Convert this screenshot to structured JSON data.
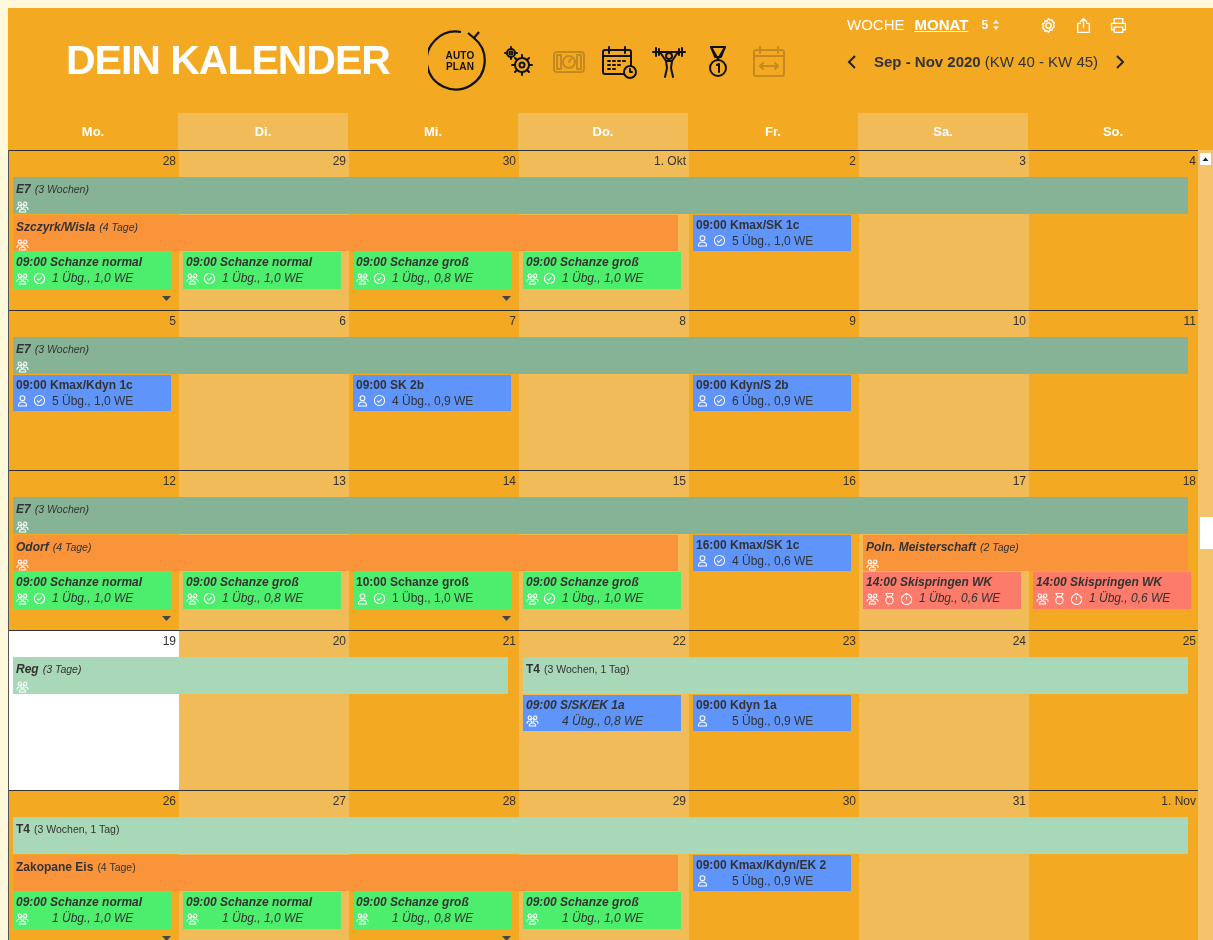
{
  "header": {
    "title": "DEIN KALENDER"
  },
  "toolbar": {
    "autoplan": {
      "line1": "AUTO",
      "line2": "PLAN"
    },
    "tools": [
      {
        "kind": "gears",
        "disabled": false
      },
      {
        "kind": "scale",
        "disabled": true
      },
      {
        "kind": "calendar-clock",
        "disabled": false
      },
      {
        "kind": "athlete",
        "disabled": false
      },
      {
        "kind": "medal",
        "disabled": false
      },
      {
        "kind": "calendar-arrows",
        "disabled": true
      }
    ]
  },
  "view_modes": [
    {
      "label": "WOCHE",
      "selected": false
    },
    {
      "label": "MONAT",
      "selected": true
    }
  ],
  "weeks_shown": "5",
  "actions": [
    {
      "kind": "settings"
    },
    {
      "kind": "share"
    },
    {
      "kind": "print"
    }
  ],
  "range": {
    "label": "Sep - Nov 2020",
    "weeks": "(KW 40 - KW 45)"
  },
  "weekdays": [
    "Mo.",
    "Di.",
    "Mi.",
    "Do.",
    "Fr.",
    "Sa.",
    "So."
  ],
  "weeks": [
    {
      "days": [
        {
          "date": "28",
          "today": false,
          "more": true
        },
        {
          "date": "29",
          "today": false,
          "more": false
        },
        {
          "date": "30",
          "today": false,
          "more": true
        },
        {
          "date": "1. Okt",
          "today": false,
          "more": false
        },
        {
          "date": "2",
          "today": false,
          "more": false
        },
        {
          "date": "3",
          "today": false,
          "more": false
        },
        {
          "date": "4",
          "today": false,
          "more": false
        }
      ],
      "lanes": [
        [
          {
            "kind": "band",
            "title": "E7",
            "note": "(3 Wochen)",
            "color": "#86b396",
            "planned": true,
            "team": true
          },
          {
            "kind": "continued"
          },
          {
            "kind": "continued"
          },
          {
            "kind": "continued"
          },
          {
            "kind": "continued"
          },
          {
            "kind": "continued"
          },
          {
            "kind": "continued"
          }
        ],
        [
          {
            "kind": "band",
            "title": "Szczyrk/Wisla",
            "note": "(4 Tage)",
            "color": "#f9943a",
            "planned": true,
            "team": true
          },
          {
            "kind": "continued"
          },
          {
            "kind": "continued"
          },
          {
            "kind": "continued"
          },
          {
            "kind": "session",
            "title": "09:00 Kmax/SK 1c",
            "info": "5 Übg., 1,0 WE",
            "color": "#5f94fb",
            "planned": false,
            "team": false,
            "checked": true,
            "competition": false
          }
        ],
        [
          {
            "kind": "session",
            "title": "09:00 Schanze normal",
            "info": "1 Übg., 1,0 WE",
            "color": "#4ded6d",
            "planned": true,
            "team": true,
            "checked": true,
            "competition": false
          },
          {
            "kind": "session",
            "title": "09:00 Schanze normal",
            "info": "1 Übg., 1,0 WE",
            "color": "#4ded6d",
            "planned": true,
            "team": true,
            "checked": true,
            "competition": false
          },
          {
            "kind": "session",
            "title": "09:00 Schanze groß",
            "info": "1 Übg., 0,8 WE",
            "color": "#4ded6d",
            "planned": true,
            "team": true,
            "checked": true,
            "competition": false
          },
          {
            "kind": "session",
            "title": "09:00 Schanze groß",
            "info": "1 Übg., 1,0 WE",
            "color": "#4ded6d",
            "planned": true,
            "team": true,
            "checked": true,
            "competition": false
          }
        ]
      ]
    },
    {
      "days": [
        {
          "date": "5",
          "today": false,
          "more": false
        },
        {
          "date": "6",
          "today": false,
          "more": false
        },
        {
          "date": "7",
          "today": false,
          "more": false
        },
        {
          "date": "8",
          "today": false,
          "more": false
        },
        {
          "date": "9",
          "today": false,
          "more": false
        },
        {
          "date": "10",
          "today": false,
          "more": false
        },
        {
          "date": "11",
          "today": false,
          "more": false
        }
      ],
      "lanes": [
        [
          {
            "kind": "band",
            "title": "E7",
            "note": "(3 Wochen)",
            "color": "#86b396",
            "planned": true,
            "team": true
          },
          {
            "kind": "continued"
          },
          {
            "kind": "continued"
          },
          {
            "kind": "continued"
          },
          {
            "kind": "continued"
          },
          {
            "kind": "continued"
          },
          {
            "kind": "continued"
          }
        ],
        [
          {
            "kind": "session",
            "title": "09:00 Kmax/Kdyn 1c",
            "info": "5 Übg., 1,0 WE",
            "color": "#5f94fb",
            "planned": false,
            "team": false,
            "checked": true,
            "competition": false
          },
          {
            "kind": "empty"
          },
          {
            "kind": "session",
            "title": "09:00 SK 2b",
            "info": "4 Übg., 0,9 WE",
            "color": "#5f94fb",
            "planned": false,
            "team": false,
            "checked": true,
            "competition": false
          },
          {
            "kind": "empty"
          },
          {
            "kind": "session",
            "title": "09:00 Kdyn/S 2b",
            "info": "6 Übg., 0,9 WE",
            "color": "#5f94fb",
            "planned": false,
            "team": false,
            "checked": true,
            "competition": false
          }
        ]
      ]
    },
    {
      "days": [
        {
          "date": "12",
          "today": false,
          "more": true
        },
        {
          "date": "13",
          "today": false,
          "more": false
        },
        {
          "date": "14",
          "today": false,
          "more": true
        },
        {
          "date": "15",
          "today": false,
          "more": false
        },
        {
          "date": "16",
          "today": false,
          "more": false
        },
        {
          "date": "17",
          "today": false,
          "more": false
        },
        {
          "date": "18",
          "today": false,
          "more": false
        }
      ],
      "lanes": [
        [
          {
            "kind": "band",
            "title": "E7",
            "note": "(3 Wochen)",
            "color": "#86b396",
            "planned": true,
            "team": true
          },
          {
            "kind": "continued"
          },
          {
            "kind": "continued"
          },
          {
            "kind": "continued"
          },
          {
            "kind": "continued"
          },
          {
            "kind": "continued"
          },
          {
            "kind": "continued"
          }
        ],
        [
          {
            "kind": "band",
            "title": "Odorf",
            "note": "(4 Tage)",
            "color": "#f9943a",
            "planned": true,
            "team": true
          },
          {
            "kind": "continued"
          },
          {
            "kind": "continued"
          },
          {
            "kind": "continued"
          },
          {
            "kind": "session",
            "title": "16:00 Kmax/SK 1c",
            "info": "4 Übg., 0,6 WE",
            "color": "#5f94fb",
            "planned": false,
            "team": false,
            "checked": true,
            "competition": false
          },
          {
            "kind": "band",
            "title": "Poln. Meisterschaft",
            "note": "(2 Tage)",
            "color": "#f9943a",
            "planned": true,
            "team": true
          },
          {
            "kind": "continued"
          }
        ],
        [
          {
            "kind": "session",
            "title": "09:00 Schanze normal",
            "info": "1 Übg., 1,0 WE",
            "color": "#4ded6d",
            "planned": true,
            "team": true,
            "checked": true,
            "competition": false
          },
          {
            "kind": "session",
            "title": "09:00 Schanze groß",
            "info": "1 Übg., 0,8 WE",
            "color": "#4ded6d",
            "planned": true,
            "team": true,
            "checked": true,
            "competition": false
          },
          {
            "kind": "session",
            "title": "10:00 Schanze groß",
            "info": "1 Übg., 1,0 WE",
            "color": "#4ded6d",
            "planned": false,
            "team": false,
            "checked": true,
            "competition": false
          },
          {
            "kind": "session",
            "title": "09:00 Schanze groß",
            "info": "1 Übg., 1,0 WE",
            "color": "#4ded6d",
            "planned": true,
            "team": true,
            "checked": true,
            "competition": false
          },
          {
            "kind": "empty"
          },
          {
            "kind": "session",
            "title": "14:00 Skispringen WK",
            "info": "1 Übg., 0,6 WE",
            "color": "#fc7b6b",
            "planned": true,
            "team": true,
            "competition": true
          },
          {
            "kind": "session",
            "title": "14:00 Skispringen WK",
            "info": "1 Übg., 0,6 WE",
            "color": "#fc7b6b",
            "planned": true,
            "team": true,
            "competition": true
          }
        ]
      ]
    },
    {
      "days": [
        {
          "date": "19",
          "today": true,
          "more": false
        },
        {
          "date": "20",
          "today": false,
          "more": false
        },
        {
          "date": "21",
          "today": false,
          "more": false
        },
        {
          "date": "22",
          "today": false,
          "more": false
        },
        {
          "date": "23",
          "today": false,
          "more": false
        },
        {
          "date": "24",
          "today": false,
          "more": false
        },
        {
          "date": "25",
          "today": false,
          "more": false
        }
      ],
      "lanes": [
        [
          {
            "kind": "band",
            "title": "Reg",
            "note": "(3 Tage)",
            "color": "#a8d8b8",
            "planned": true,
            "team": true
          },
          {
            "kind": "continued"
          },
          {
            "kind": "continued"
          },
          {
            "kind": "band",
            "title": "T4",
            "note": "(3 Wochen, 1 Tag)",
            "color": "#a8d8b8",
            "planned": false,
            "team": false
          },
          {
            "kind": "continued"
          },
          {
            "kind": "continued"
          },
          {
            "kind": "continued"
          }
        ],
        [
          {
            "kind": "empty"
          },
          {
            "kind": "empty"
          },
          {
            "kind": "empty"
          },
          {
            "kind": "session",
            "title": "09:00 S/SK/EK 1a",
            "info": "4 Übg., 0,8 WE",
            "color": "#5f94fb",
            "planned": true,
            "team": true,
            "checked": false,
            "competition": false
          },
          {
            "kind": "session",
            "title": "09:00 Kdyn 1a",
            "info": "5 Übg., 0,9 WE",
            "color": "#5f94fb",
            "planned": false,
            "team": false,
            "checked": false,
            "competition": false
          }
        ]
      ]
    },
    {
      "days": [
        {
          "date": "26",
          "today": false,
          "more": true
        },
        {
          "date": "27",
          "today": false,
          "more": false
        },
        {
          "date": "28",
          "today": false,
          "more": true
        },
        {
          "date": "29",
          "today": false,
          "more": false
        },
        {
          "date": "30",
          "today": false,
          "more": false
        },
        {
          "date": "31",
          "today": false,
          "more": false
        },
        {
          "date": "1. Nov",
          "today": false,
          "more": false
        }
      ],
      "lanes": [
        [
          {
            "kind": "band",
            "title": "T4",
            "note": "(3 Wochen, 1 Tag)",
            "color": "#a8d8b8",
            "planned": false,
            "team": false
          },
          {
            "kind": "continued"
          },
          {
            "kind": "continued"
          },
          {
            "kind": "continued"
          },
          {
            "kind": "continued"
          },
          {
            "kind": "continued"
          },
          {
            "kind": "continued"
          }
        ],
        [
          {
            "kind": "band",
            "title": "Zakopane Eis",
            "note": "(4 Tage)",
            "color": "#f9943a",
            "planned": false,
            "team": false
          },
          {
            "kind": "continued"
          },
          {
            "kind": "continued"
          },
          {
            "kind": "continued"
          },
          {
            "kind": "session",
            "title": "09:00 Kmax/Kdyn/EK 2",
            "info": "5 Übg., 0,9 WE",
            "color": "#5f94fb",
            "planned": false,
            "team": false,
            "checked": false,
            "competition": false
          }
        ],
        [
          {
            "kind": "session",
            "title": "09:00 Schanze normal",
            "info": "1 Übg., 1,0 WE",
            "color": "#4ded6d",
            "planned": true,
            "team": true,
            "checked": false,
            "competition": false
          },
          {
            "kind": "session",
            "title": "09:00 Schanze normal",
            "info": "1 Übg., 1,0 WE",
            "color": "#4ded6d",
            "planned": true,
            "team": true,
            "checked": false,
            "competition": false
          },
          {
            "kind": "session",
            "title": "09:00 Schanze groß",
            "info": "1 Übg., 0,8 WE",
            "color": "#4ded6d",
            "planned": true,
            "team": true,
            "checked": false,
            "competition": false
          },
          {
            "kind": "session",
            "title": "09:00 Schanze groß",
            "info": "1 Übg., 1,0 WE",
            "color": "#4ded6d",
            "planned": true,
            "team": true,
            "checked": false,
            "competition": false
          }
        ]
      ]
    }
  ]
}
